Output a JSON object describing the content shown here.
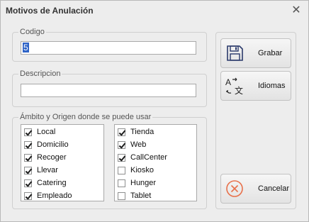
{
  "window": {
    "title": "Motivos de Anulación",
    "close_glyph": "✕"
  },
  "codigo": {
    "label": "Codigo",
    "value": "5"
  },
  "descripcion": {
    "label": "Descripcion",
    "value": ""
  },
  "ambito": {
    "label": "Ámbito y Origen donde se puede usar",
    "left": [
      {
        "label": "Local",
        "checked": true
      },
      {
        "label": "Domicilio",
        "checked": true
      },
      {
        "label": "Recoger",
        "checked": true
      },
      {
        "label": "Llevar",
        "checked": true
      },
      {
        "label": "Catering",
        "checked": true
      },
      {
        "label": "Empleado",
        "checked": true
      }
    ],
    "right": [
      {
        "label": "Tienda",
        "checked": true
      },
      {
        "label": "Web",
        "checked": true
      },
      {
        "label": "CallCenter",
        "checked": true
      },
      {
        "label": "Kiosko",
        "checked": false
      },
      {
        "label": "Hunger",
        "checked": false
      },
      {
        "label": "Tablet",
        "checked": false
      }
    ]
  },
  "buttons": {
    "grabar": {
      "label": "Grabar",
      "icon": "floppy-disk-icon"
    },
    "idiomas": {
      "label": "Idiomas",
      "icon": "translate-icon"
    },
    "cancelar": {
      "label": "Cancelar",
      "icon": "cancel-circle-icon",
      "color": "#e8704a"
    }
  }
}
